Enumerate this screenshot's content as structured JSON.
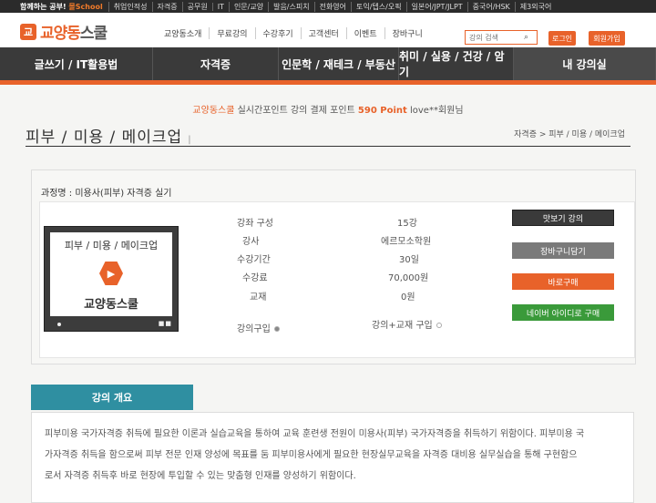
{
  "topbar": {
    "slogan_main": "함께하는 공부!",
    "slogan_brand": "몰School",
    "links": [
      "취업인적성",
      "자격증",
      "공무원",
      "IT",
      "인문/교양",
      "발음/스피치",
      "전화영어",
      "토익/텝스/오픽",
      "일본어/JPT/JLPT",
      "중국어/HSK",
      "제3외국어"
    ]
  },
  "header": {
    "logo_mark": "교",
    "logo_text_1": "교양동",
    "logo_text_2": "스쿨",
    "nav": [
      "교양동소개",
      "무료강의",
      "수강후기",
      "고객센터",
      "이벤트",
      "장바구니"
    ],
    "search_placeholder": "강의 검색",
    "login": "로그인",
    "join": "회원가입"
  },
  "categories": [
    "글쓰기 / IT활용법",
    "자격증",
    "인문학 / 재테크 / 부동산",
    "취미 / 실용 / 건강 / 암기",
    "내 강의실"
  ],
  "notice": {
    "brand": "교양동스쿨",
    "text_1": " 실시간포인트 강의 결제 포인트 ",
    "point": "590 Point",
    "text_2": " love**회원님"
  },
  "page": {
    "title": "피부 / 미용 / 메이크업",
    "breadcrumb": "자격증 > 피부 / 미용 / 메이크업"
  },
  "course": {
    "name": "과정명 : 미용사(피부) 자격증 실기",
    "thumb_title": "피부 / 미용 / 메이크업",
    "thumb_logo": "교양동스쿨",
    "info": [
      {
        "label": "강좌 구성",
        "value": "15강"
      },
      {
        "label": "강사",
        "value": "에르모소학원"
      },
      {
        "label": "수강기간",
        "value": "30일"
      },
      {
        "label": "수강료",
        "value": "70,000원"
      },
      {
        "label": "교재",
        "value": "0원"
      }
    ],
    "option_lecture": "강의구입",
    "option_bundle": "강의+교재 구입",
    "buttons": {
      "preview": "맛보기 강의",
      "cart": "장바구니담기",
      "buy": "바로구매",
      "naver": "네이버 아이디로 구매"
    }
  },
  "overview": {
    "heading": "강의 개요",
    "lines": [
      "피부미용 국가자격증 취득에 필요한 이론과 실습교육을 통하여 교육 훈련생 전원이 미용사(피부) 국가자격증을 취득하기 위함이다. 피부미용 국",
      "가자격증 취득을 함으로써 피부 전문 인재 양성에 목표를 둠 피부미용사에게 필요한 현장실무교육을 자격증 대비용 실무실습을 통해 구현함으",
      "로서 자격증 취득후 바로 현장에 투입할 수 있는 맞춤형 인재를 양성하기 위함이다."
    ]
  },
  "colors": {
    "accent": "#e8622a",
    "dark": "#3a3a3a",
    "teal": "#2f8fa1",
    "naver_green": "#3a9a3a"
  }
}
